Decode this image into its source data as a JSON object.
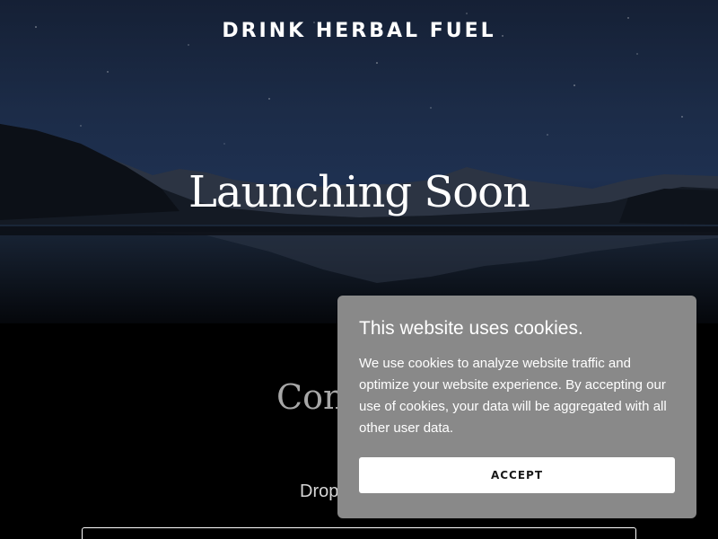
{
  "header": {
    "brand": "DRINK HERBAL FUEL"
  },
  "hero": {
    "title": "Launching Soon"
  },
  "main": {
    "contact_heading": "Con",
    "drop_text": "Drop"
  },
  "cookie_banner": {
    "title": "This website uses cookies.",
    "body": "We use cookies to analyze website traffic and optimize your website experience. By accepting our use of cookies, your data will be aggregated with all other user data.",
    "accept_label": "ACCEPT"
  },
  "colors": {
    "background": "#000000",
    "cookie_bg": "#898989",
    "heading_gray": "#a7a7a7"
  }
}
